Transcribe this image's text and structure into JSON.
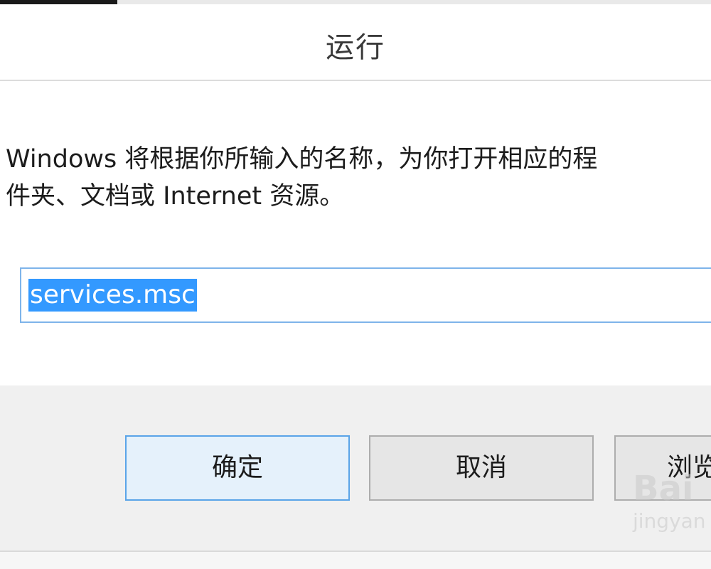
{
  "dialog": {
    "title": "运行",
    "description_line1": "Windows 将根据你所输入的名称，为你打开相应的程",
    "description_line2": "件夹、文档或 Internet 资源。",
    "input_value": "services.msc"
  },
  "buttons": {
    "ok": "确定",
    "cancel": "取消",
    "browse": "浏览"
  },
  "watermark": {
    "main": "Bai",
    "sub": "jingyan"
  },
  "colors": {
    "selection": "#3399ff",
    "input_border": "#7eb4ea",
    "default_button_border": "#5aa4e8"
  }
}
